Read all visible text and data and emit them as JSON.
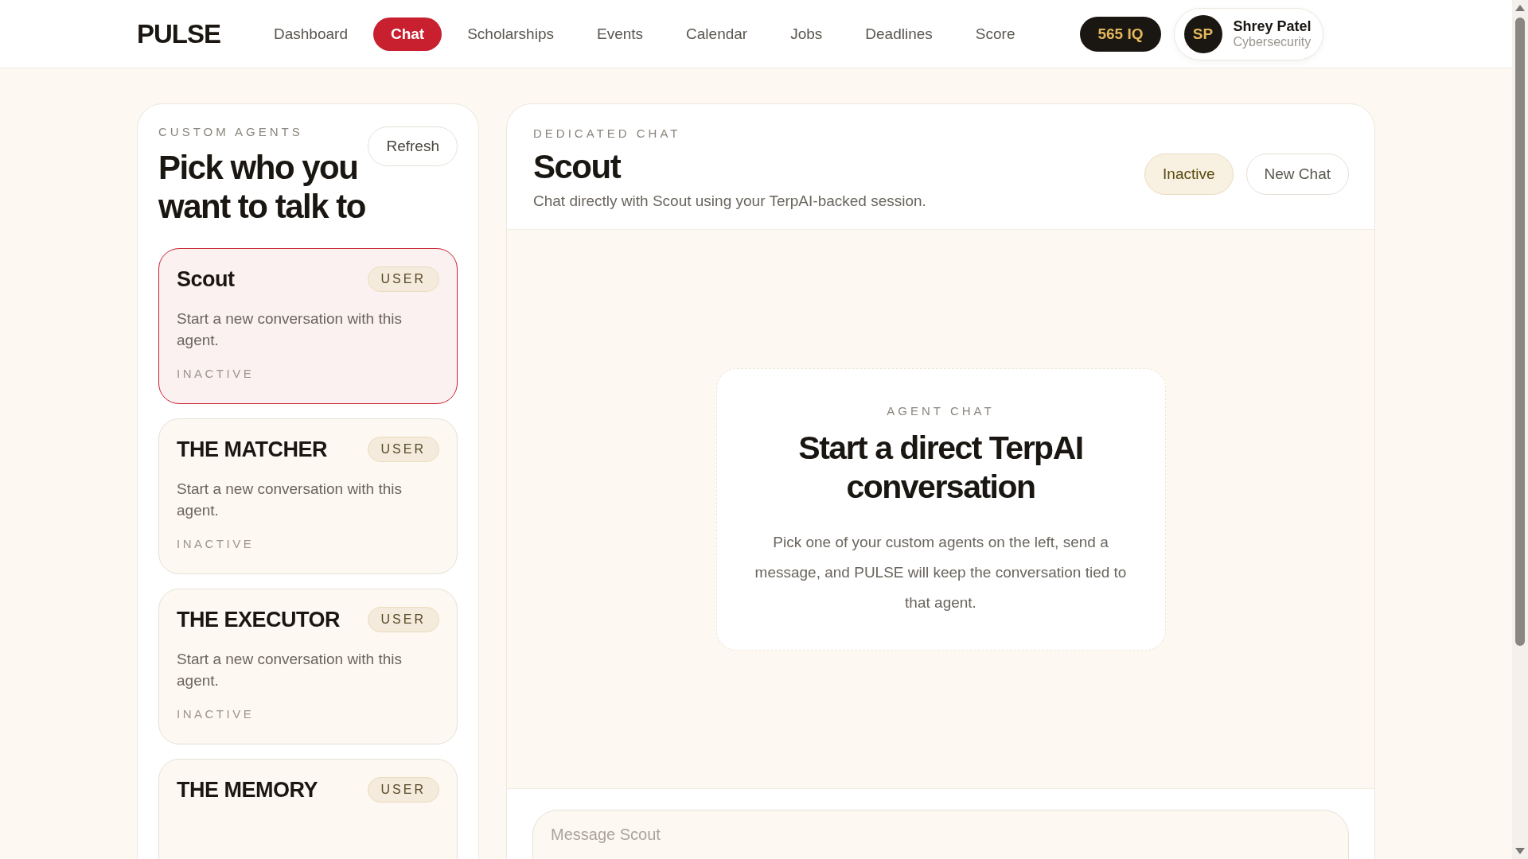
{
  "brand": "PULSE",
  "nav": [
    {
      "label": "Dashboard",
      "selected": false
    },
    {
      "label": "Chat",
      "selected": true
    },
    {
      "label": "Scholarships",
      "selected": false
    },
    {
      "label": "Events",
      "selected": false
    },
    {
      "label": "Calendar",
      "selected": false
    },
    {
      "label": "Jobs",
      "selected": false
    },
    {
      "label": "Deadlines",
      "selected": false
    },
    {
      "label": "Score",
      "selected": false
    }
  ],
  "score_badge": "565 IQ",
  "profile": {
    "initials": "SP",
    "name": "Shrey Patel",
    "subtitle": "Cybersecurity"
  },
  "agents_panel": {
    "eyebrow": "CUSTOM AGENTS",
    "title": "Pick who you want to talk to",
    "refresh_label": "Refresh",
    "agents": [
      {
        "name": "Scout",
        "badge": "USER",
        "description": "Start a new conversation with this agent.",
        "status": "INACTIVE",
        "selected": true
      },
      {
        "name": "THE MATCHER",
        "badge": "USER",
        "description": "Start a new conversation with this agent.",
        "status": "INACTIVE",
        "selected": false
      },
      {
        "name": "THE EXECUTOR",
        "badge": "USER",
        "description": "Start a new conversation with this agent.",
        "status": "INACTIVE",
        "selected": false
      },
      {
        "name": "THE MEMORY",
        "badge": "USER",
        "selected": false
      }
    ]
  },
  "chat": {
    "eyebrow": "DEDICATED CHAT",
    "title": "Scout",
    "subtitle": "Chat directly with Scout using your TerpAI-backed session.",
    "status_label": "Inactive",
    "new_chat_label": "New Chat",
    "empty_state": {
      "eyebrow": "AGENT CHAT",
      "title": "Start a direct TerpAI conversation",
      "body": "Pick one of your custom agents on the left, send a message, and PULSE will keep the conversation tied to that agent."
    },
    "message_input": {
      "placeholder": "Message Scout"
    }
  }
}
